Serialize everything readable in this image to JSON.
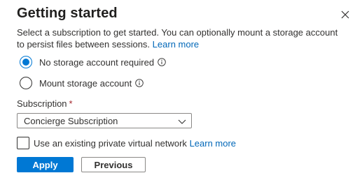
{
  "dialog": {
    "title": "Getting started",
    "description": "Select a subscription to get started. You can optionally mount a storage account to persist files between sessions.",
    "learn_more": "Learn more"
  },
  "storage_options": [
    {
      "label": "No storage account required",
      "selected": true
    },
    {
      "label": "Mount storage account",
      "selected": false
    }
  ],
  "subscription": {
    "label": "Subscription",
    "required_marker": "*",
    "value": "Concierge Subscription"
  },
  "vnet": {
    "label": "Use an existing private virtual network",
    "checked": false,
    "learn_more": "Learn more"
  },
  "buttons": {
    "apply": "Apply",
    "previous": "Previous"
  },
  "icons": {
    "close": "close-icon",
    "info": "info-icon",
    "chevron": "chevron-down-icon"
  },
  "colors": {
    "accent": "#0078d4",
    "link": "#0067b8",
    "required": "#a4262c"
  }
}
